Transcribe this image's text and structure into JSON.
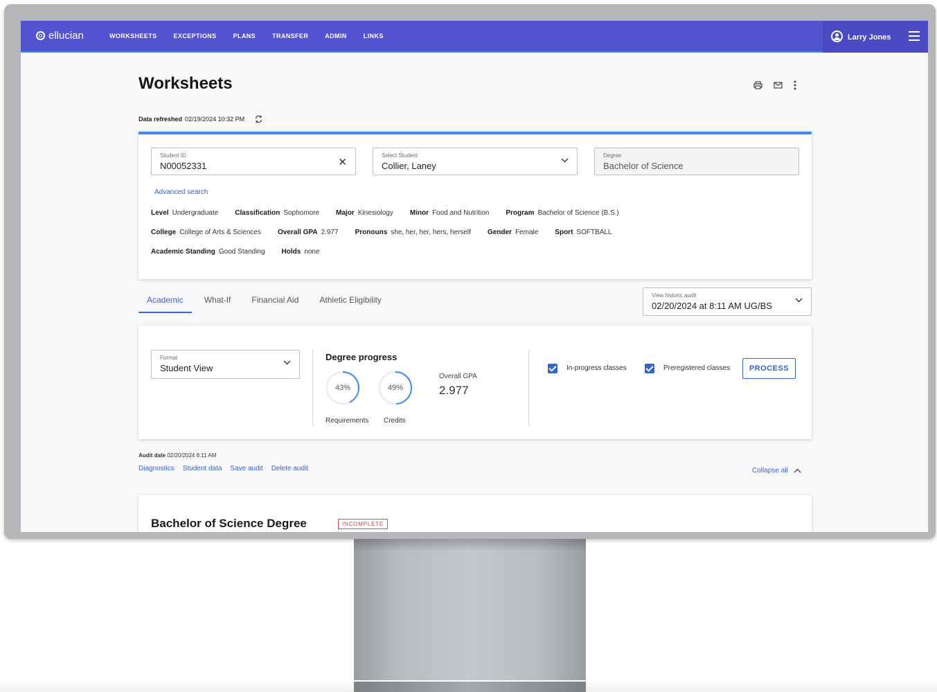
{
  "brand": {
    "name": "ellucian"
  },
  "nav": {
    "links": [
      "WORKSHEETS",
      "EXCEPTIONS",
      "PLANS",
      "TRANSFER",
      "ADMIN",
      "LINKS"
    ],
    "user_name": "Larry Jones"
  },
  "page": {
    "title": "Worksheets",
    "refresh_label": "Data refreshed",
    "refresh_value": "02/19/2024 10:32 PM"
  },
  "student": {
    "id_label": "Student ID",
    "id_value": "N00052331",
    "select_label": "Select Student",
    "select_value": "Collier, Laney",
    "degree_label": "Degree",
    "degree_value": "Bachelor of Science",
    "advanced_search": "Advanced search",
    "info_rows": [
      [
        {
          "label": "Level",
          "value": "Undergraduate"
        },
        {
          "label": "Classification",
          "value": "Sophomore"
        },
        {
          "label": "Major",
          "value": "Kinesiology"
        },
        {
          "label": "Minor",
          "value": "Food and Nutrition"
        },
        {
          "label": "Program",
          "value": "Bachelor of Science (B.S.)"
        }
      ],
      [
        {
          "label": "College",
          "value": "College of Arts & Sciences"
        },
        {
          "label": "Overall GPA",
          "value": "2.977"
        },
        {
          "label": "Pronouns",
          "value": "she, her, her, hers, herself"
        },
        {
          "label": "Gender",
          "value": "Female"
        },
        {
          "label": "Sport",
          "value": "SOFTBALL"
        }
      ],
      [
        {
          "label": "Academic Standing",
          "value": "Good Standing"
        },
        {
          "label": "Holds",
          "value": "none"
        }
      ]
    ]
  },
  "tabs": [
    "Academic",
    "What-If",
    "Financial Aid",
    "Athletic Eligibility"
  ],
  "historic_audit": {
    "label": "View historic audit",
    "value": "02/20/2024 at 8:11 AM UG/BS"
  },
  "progress": {
    "format_label": "Format",
    "format_value": "Student View",
    "title": "Degree progress",
    "requirements_pct": 43,
    "requirements_text": "43%",
    "requirements_label": "Requirements",
    "credits_pct": 49,
    "credits_text": "49%",
    "credits_label": "Credits",
    "gpa_label": "Overall GPA",
    "gpa_value": "2.977",
    "inprogress_label": "In-progress classes",
    "preregistered_label": "Preregistered classes",
    "process_label": "PROCESS"
  },
  "audit": {
    "date_label": "Audit date",
    "date_value": "02/20/2024 8:11 AM",
    "links": [
      "Diagnostics",
      "Student data",
      "Save audit",
      "Delete audit"
    ],
    "collapse_all": "Collapse all"
  },
  "degree_block": {
    "title": "Bachelor of Science Degree",
    "status": "INCOMPLETE"
  },
  "colors": {
    "nav_bg": "#5353d1",
    "accent": "#3463d3",
    "progress_ring": "#3d8bf5",
    "incomplete": "#e3453b"
  }
}
